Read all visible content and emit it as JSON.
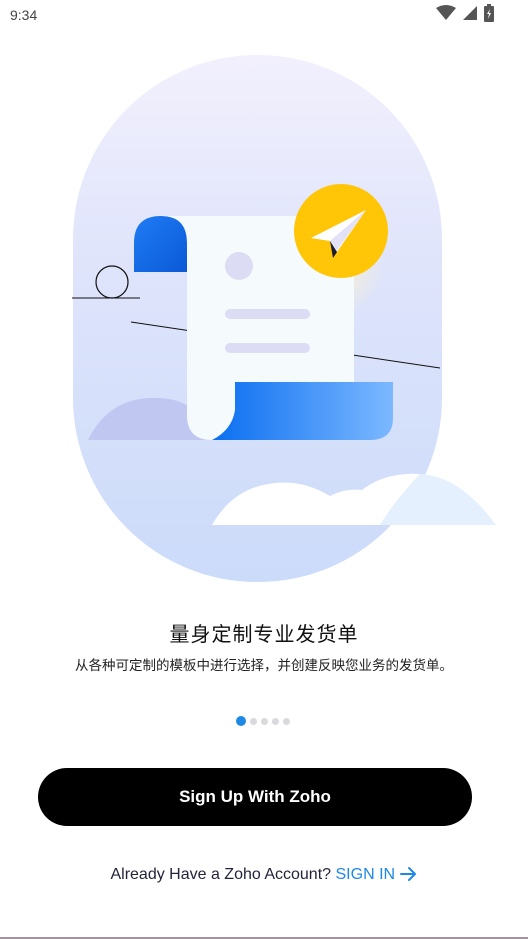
{
  "status_bar": {
    "time": "9:34",
    "icons": [
      "wifi-icon",
      "signal-icon",
      "battery-icon"
    ]
  },
  "onboarding": {
    "title": "量身定制专业发货单",
    "subtitle": "从各种可定制的模板中进行选择，并创建反映您业务的发货单。",
    "page_count": 5,
    "active_page": 1
  },
  "actions": {
    "signup_label": "Sign Up With Zoho",
    "already_text": "Already Have a Zoho Account?",
    "signin_label": "SIGN IN"
  },
  "colors": {
    "accent": "#1e88e5",
    "button_bg": "#000000",
    "illustration_oval_top": "#efeefc",
    "illustration_oval_bottom": "#cddcfa",
    "paper_plane_badge": "#ffc107"
  }
}
